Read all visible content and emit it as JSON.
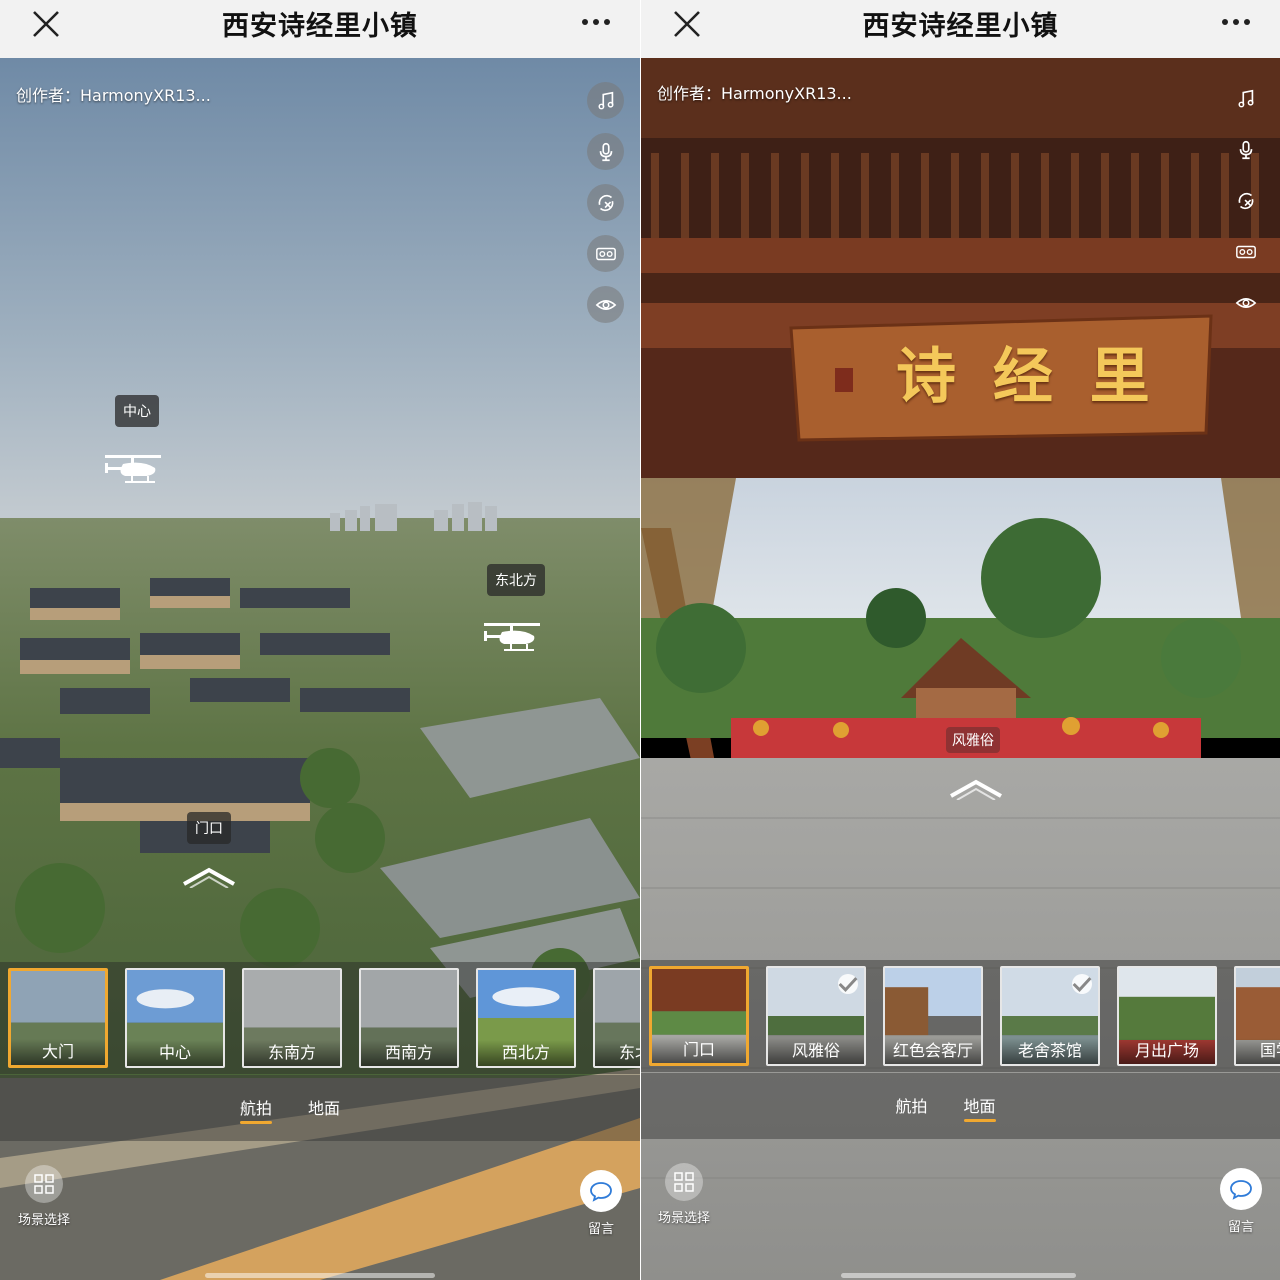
{
  "app": {
    "title": "西安诗经里小镇"
  },
  "left": {
    "author": "创作者：HarmonyXR13...",
    "hotspots": {
      "center": "中心",
      "northeast": "东北方",
      "gate": "门口"
    },
    "thumbnails": [
      {
        "label": "大门",
        "active": true
      },
      {
        "label": "中心"
      },
      {
        "label": "东南方"
      },
      {
        "label": "西南方"
      },
      {
        "label": "西北方"
      },
      {
        "label": "东北方"
      }
    ],
    "tabs": [
      {
        "label": "航拍",
        "active": true
      },
      {
        "label": "地面"
      }
    ],
    "scene_select": "场景选择",
    "message": "留言"
  },
  "right": {
    "author": "创作者：HarmonyXR13...",
    "sign_text": "诗 经 里",
    "hotspots": {
      "fengyasu": "风雅俗"
    },
    "thumbnails": [
      {
        "label": "门口",
        "active": true
      },
      {
        "label": "风雅俗",
        "checked": true
      },
      {
        "label": "红色会客厅"
      },
      {
        "label": "老舍茶馆",
        "checked": true
      },
      {
        "label": "月出广场"
      },
      {
        "label": "国学馆"
      }
    ],
    "tabs": [
      {
        "label": "航拍"
      },
      {
        "label": "地面",
        "active": true
      }
    ],
    "scene_select": "场景选择",
    "message": "留言"
  },
  "icons": [
    "close-icon",
    "more-icon",
    "music-icon",
    "microphone-icon",
    "gyroscope-icon",
    "vr-glasses-icon",
    "eye-icon",
    "helicopter-icon",
    "forward-arrow-icon",
    "grid-icon",
    "chat-icon",
    "check-icon"
  ],
  "colors": {
    "accent": "#f0a830",
    "topbar": "#f2f2f2"
  }
}
